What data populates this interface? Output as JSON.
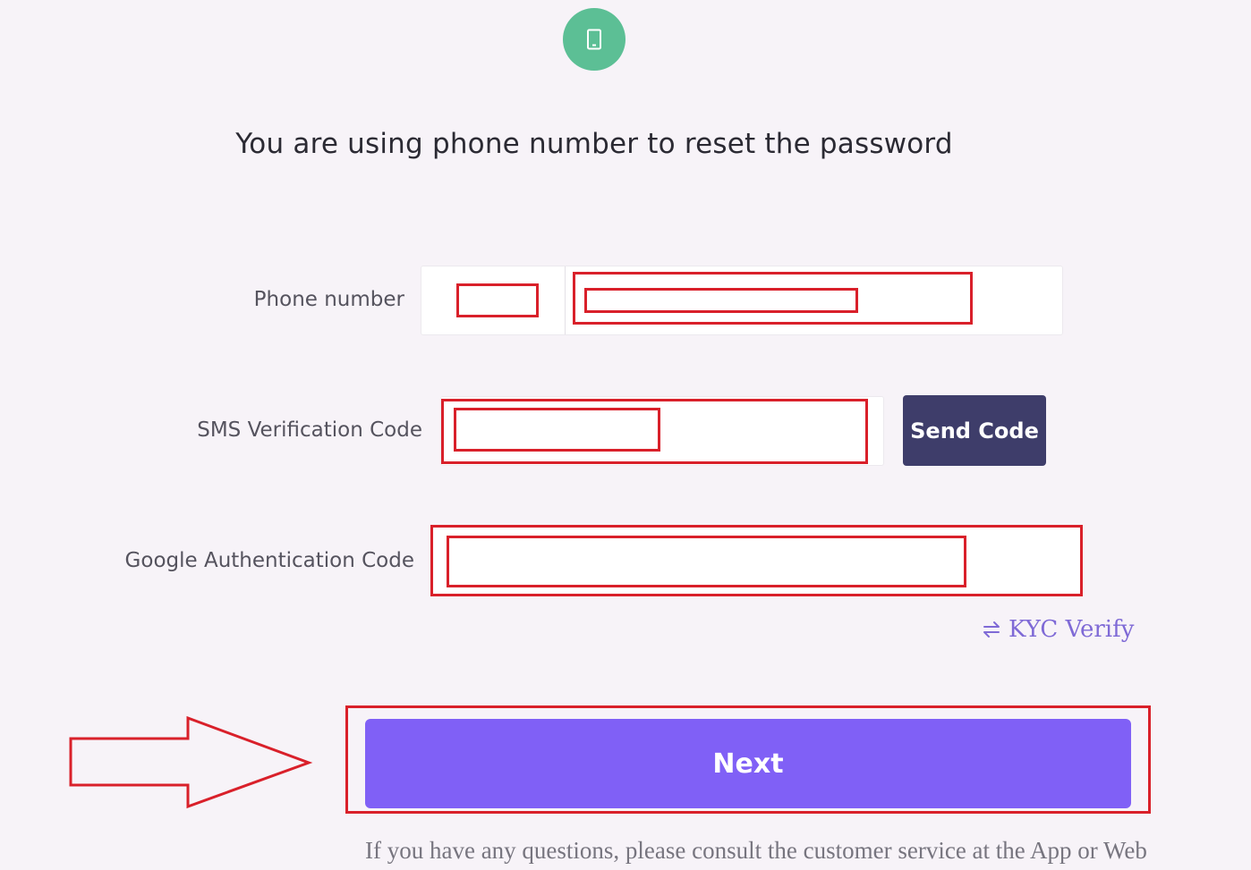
{
  "header": {
    "icon": "phone-icon",
    "icon_bg_color": "#5cbf95",
    "title": "You are using phone number to reset the password"
  },
  "form": {
    "phone": {
      "label": "Phone number",
      "country_code_value": "",
      "number_value": ""
    },
    "sms": {
      "label": "SMS Verification Code",
      "value": "",
      "send_button_label": "Send Code"
    },
    "google_auth": {
      "label": "Google Authentication Code",
      "value": ""
    },
    "kyc_link": {
      "icon": "swap-arrows-icon",
      "label": "KYC Verify"
    },
    "next_button_label": "Next"
  },
  "footer": {
    "note": "If you have any questions, please consult the customer service at the App or Web"
  },
  "colors": {
    "background": "#f7f3f8",
    "annotation_red": "#d9202a",
    "send_button": "#3e3d6a",
    "next_button": "#8060f6",
    "link": "#7f6ad6"
  },
  "annotations": {
    "arrow": "right-arrow-annotation",
    "highlight": "red-highlight-boxes"
  }
}
